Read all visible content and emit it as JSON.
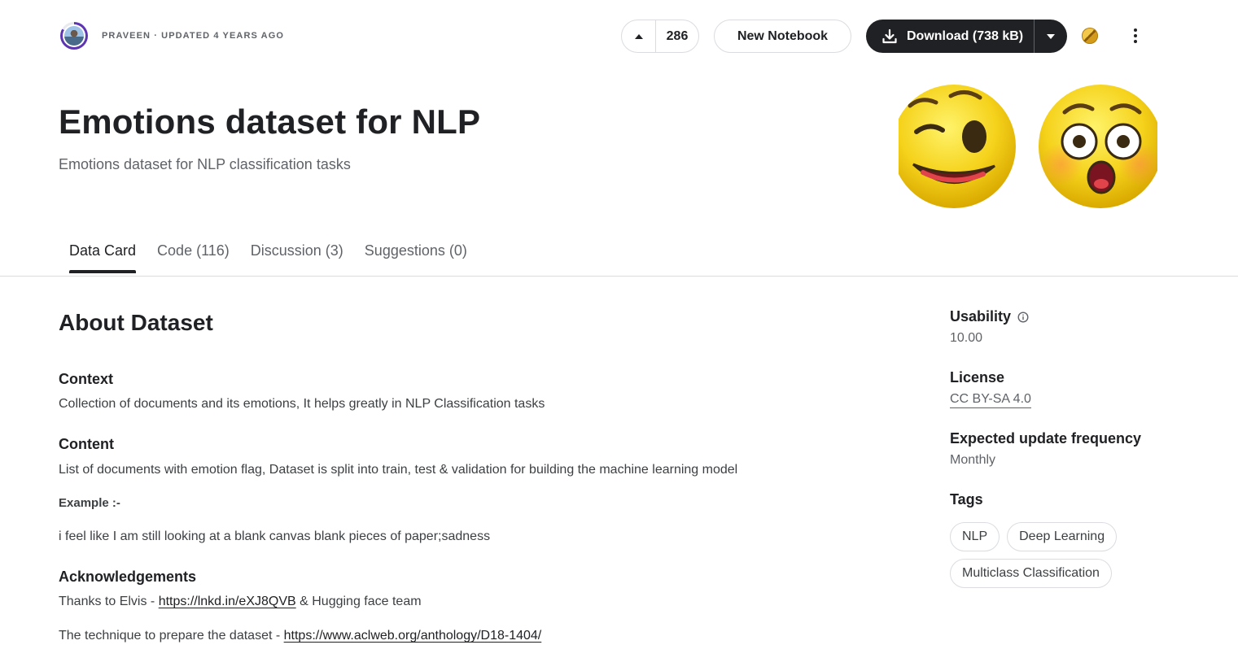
{
  "header": {
    "author": "Praveen",
    "updated": "· Updated 4 years ago",
    "upvotes": "286",
    "new_notebook_label": "New Notebook",
    "download_label": "Download (738 kB)"
  },
  "dataset": {
    "title": "Emotions dataset for NLP",
    "subtitle": "Emotions dataset for NLP classification tasks"
  },
  "tabs": [
    {
      "label": "Data Card"
    },
    {
      "label": "Code (116)"
    },
    {
      "label": "Discussion (3)"
    },
    {
      "label": "Suggestions (0)"
    }
  ],
  "about": {
    "heading": "About Dataset",
    "context_heading": "Context",
    "context_text": "Collection of documents and its emotions, It helps greatly in NLP Classification tasks",
    "content_heading": "Content",
    "content_text": "List of documents with emotion flag, Dataset is split into train, test & validation for building the machine learning model",
    "example_label": "Example :-",
    "example_text": "i feel like I am still looking at a blank canvas blank pieces of paper;sadness",
    "ack_heading": "Acknowledgements",
    "ack_prefix": "Thanks to Elvis - ",
    "ack_link": "https://lnkd.in/eXJ8QVB",
    "ack_suffix": " & Hugging face team",
    "technique_prefix": "The technique to prepare the dataset - ",
    "technique_link": "https://www.aclweb.org/anthology/D18-1404/"
  },
  "sidebar": {
    "usability_label": "Usability",
    "usability_value": "10.00",
    "license_label": "License",
    "license_value": "CC BY-SA 4.0",
    "frequency_label": "Expected update frequency",
    "frequency_value": "Monthly",
    "tags_label": "Tags",
    "tags": [
      "NLP",
      "Deep Learning",
      "Multiclass Classification"
    ]
  },
  "icons": {
    "upvote": "caret-up-icon",
    "download": "download-icon",
    "dropdown": "chevron-down-icon",
    "medal": "gold-medal-icon",
    "more": "more-vert-icon",
    "info": "info-icon"
  },
  "colors": {
    "text_primary": "#202124",
    "text_secondary": "#5f6368",
    "border": "#dadce0",
    "download_bg": "#202124",
    "avatar_ring": "#5e35b1",
    "medal_gold": "#d49b1a"
  }
}
